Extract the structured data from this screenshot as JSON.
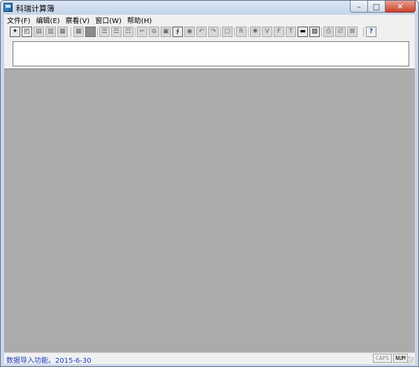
{
  "window": {
    "title": "科瑞计算簿",
    "buttons": {
      "minimize": "–",
      "maximize": "□",
      "close": "✕"
    }
  },
  "menu": {
    "items": [
      "文件(F)",
      "编辑(E)",
      "察看(V)",
      "窗口(W)",
      "帮助(H)"
    ]
  },
  "toolbar": {
    "buttons": [
      {
        "name": "new-doc-icon",
        "glyph": "✦",
        "active": true
      },
      {
        "name": "open-doc-icon",
        "glyph": "◰",
        "active": true
      },
      {
        "name": "save-icon",
        "glyph": "▤",
        "active": false
      },
      {
        "name": "import-icon",
        "glyph": "▥",
        "active": false
      },
      {
        "name": "export-icon",
        "glyph": "▦",
        "active": false
      },
      {
        "name": "table-icon",
        "glyph": "▦",
        "active": false
      },
      {
        "name": "fill-icon",
        "glyph": "",
        "active": false,
        "dark": true
      },
      {
        "name": "align-left-icon",
        "glyph": "☰",
        "active": false
      },
      {
        "name": "align-center-icon",
        "glyph": "☲",
        "active": false
      },
      {
        "name": "align-right-icon",
        "glyph": "☶",
        "active": false
      },
      {
        "name": "cut-icon",
        "glyph": "✂",
        "active": false
      },
      {
        "name": "copy-icon",
        "glyph": "⧉",
        "active": false
      },
      {
        "name": "paste-icon",
        "glyph": "▣",
        "active": false
      },
      {
        "name": "formula-icon",
        "glyph": "∮",
        "active": true
      },
      {
        "name": "find-icon",
        "glyph": "◉",
        "active": false
      },
      {
        "name": "undo-icon",
        "glyph": "↶",
        "active": false
      },
      {
        "name": "redo-icon",
        "glyph": "↷",
        "active": false
      },
      {
        "name": "calc-icon",
        "glyph": "▢",
        "active": false
      },
      {
        "name": "r-icon",
        "glyph": "R",
        "active": false
      },
      {
        "name": "settings-icon",
        "glyph": "✺",
        "active": false
      },
      {
        "name": "var-icon",
        "glyph": "V",
        "active": false
      },
      {
        "name": "func-icon",
        "glyph": "F",
        "active": false
      },
      {
        "name": "text-icon",
        "glyph": "T",
        "active": false
      },
      {
        "name": "dec-icon",
        "glyph": "▬",
        "active": true
      },
      {
        "name": "window-icon",
        "glyph": "▧",
        "active": true
      },
      {
        "name": "print-icon",
        "glyph": "⎙",
        "active": false
      },
      {
        "name": "preview-icon",
        "glyph": "⎚",
        "active": false
      },
      {
        "name": "close-doc-icon",
        "glyph": "⊠",
        "active": false
      },
      {
        "name": "help-icon",
        "glyph": "?",
        "active": true,
        "help": true
      }
    ]
  },
  "edit_box": {
    "value": ""
  },
  "statusbar": {
    "message": "数据导入功能。2015-6-30",
    "caps": "CAPS",
    "num": "NUM"
  }
}
